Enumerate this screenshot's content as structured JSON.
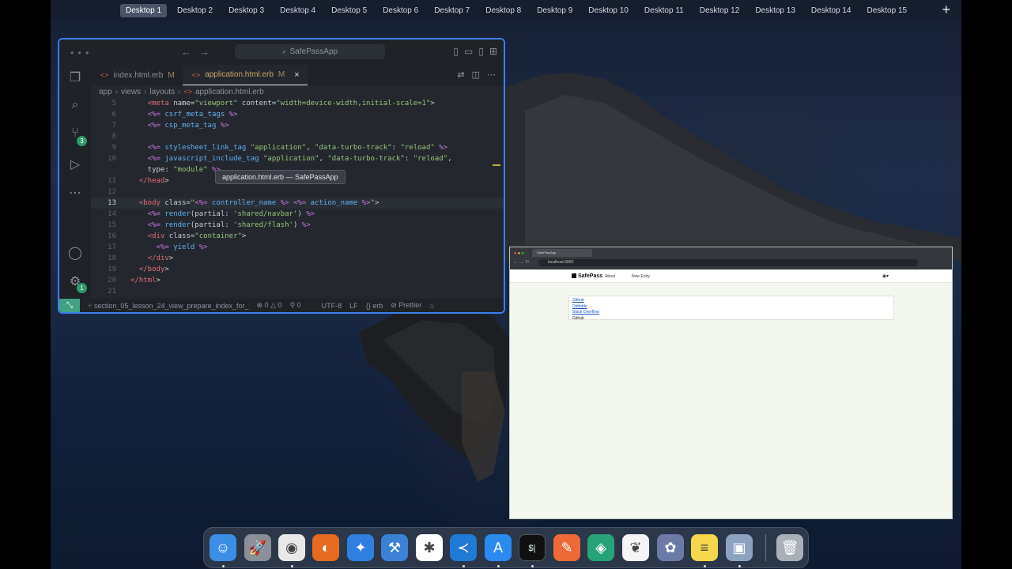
{
  "desktops": [
    "Desktop 1",
    "Desktop 2",
    "Desktop 3",
    "Desktop 4",
    "Desktop 5",
    "Desktop 6",
    "Desktop 7",
    "Desktop 8",
    "Desktop 9",
    "Desktop 10",
    "Desktop 11",
    "Desktop 12",
    "Desktop 13",
    "Desktop 14",
    "Desktop 15"
  ],
  "active_desktop": "Desktop 1",
  "add_desktop": "+",
  "vscode": {
    "search_label": "SafePassApp",
    "tabs": [
      {
        "label": "index.html.erb",
        "modified": "M"
      },
      {
        "label": "application.html.erb",
        "modified": "M",
        "close": "×"
      }
    ],
    "breadcrumb": [
      "app",
      "views",
      "layouts",
      "application.html.erb"
    ],
    "badges": {
      "source_control": "3",
      "settings": "1"
    },
    "lines": [
      {
        "n": "5",
        "text": "    <meta name=\"viewport\" content=\"width=device-width,initial-scale=1\">"
      },
      {
        "n": "6",
        "text": "    <%= csrf_meta_tags %>"
      },
      {
        "n": "7",
        "text": "    <%= csp_meta_tag %>"
      },
      {
        "n": "8",
        "text": ""
      },
      {
        "n": "9",
        "text": "    <%= stylesheet_link_tag \"application\", \"data-turbo-track\": \"reload\" %>"
      },
      {
        "n": "10",
        "text": "    <%= javascript_include_tag \"application\", \"data-turbo-track\": \"reload\","
      },
      {
        "n": "",
        "text": "    type: \"module\" %>"
      },
      {
        "n": "11",
        "text": "  </head>"
      },
      {
        "n": "12",
        "text": ""
      },
      {
        "n": "13",
        "text": "  <body class=\"<%= controller_name %> <%= action_name %>\">"
      },
      {
        "n": "14",
        "text": "    <%= render(partial: 'shared/navbar') %>"
      },
      {
        "n": "15",
        "text": "    <%= render(partial: 'shared/flash') %>"
      },
      {
        "n": "16",
        "text": "    <div class=\"container\">"
      },
      {
        "n": "17",
        "text": "      <%= yield %>"
      },
      {
        "n": "18",
        "text": "    </div>"
      },
      {
        "n": "19",
        "text": "  </body>"
      },
      {
        "n": "20",
        "text": "</html>"
      },
      {
        "n": "21",
        "text": ""
      }
    ],
    "tooltip": "application.html.erb — SafePassApp",
    "status": {
      "branch": "section_05_lesson_24_view_prepare_index_for_",
      "errors": "0",
      "warnings": "0",
      "ports": "0",
      "encoding": "UTF-8",
      "eol": "LF",
      "language": "erb",
      "formatter": "Prettier"
    }
  },
  "browser": {
    "tab_title": "SafePassApp",
    "url": "localhost:3000",
    "brand": "SafePass",
    "nav_about": "About",
    "nav_new": "New Entry",
    "links": [
      "Github",
      "Dribbble",
      "Stack Overflow"
    ],
    "plain": "Github"
  },
  "dock_apps": [
    "finder-icon",
    "launchpad-icon",
    "chrome-icon",
    "firefox-icon",
    "safari-icon",
    "xcode-icon",
    "slack-icon",
    "vscode-icon",
    "appstore-icon",
    "terminal-icon",
    "postman-icon",
    "gitkraken-icon",
    "mongodb-icon",
    "photos-icon",
    "notes-icon",
    "preview-icon",
    "trash-icon"
  ],
  "terminal_glyph": "$|"
}
